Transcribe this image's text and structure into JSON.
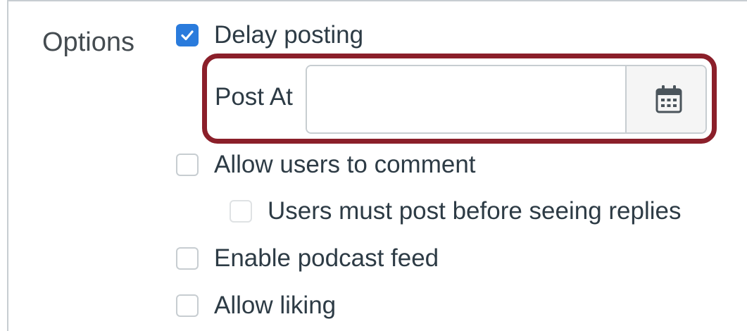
{
  "section": {
    "label": "Options"
  },
  "options": {
    "delay_posting": {
      "label": "Delay posting",
      "checked": true
    },
    "post_at": {
      "label": "Post At",
      "value": "",
      "placeholder": ""
    },
    "allow_comment": {
      "label": "Allow users to comment",
      "checked": false
    },
    "must_post": {
      "label": "Users must post before seeing replies",
      "checked": false,
      "disabled": true
    },
    "podcast_feed": {
      "label": "Enable podcast feed",
      "checked": false
    },
    "allow_liking": {
      "label": "Allow liking",
      "checked": false
    }
  },
  "icons": {
    "checkmark": "check-icon",
    "calendar": "calendar-icon"
  },
  "colors": {
    "checkbox_checked": "#2a7bdc",
    "highlight_border": "#8b1f2a",
    "text": "#2d3b45",
    "section_label": "#444b50"
  }
}
